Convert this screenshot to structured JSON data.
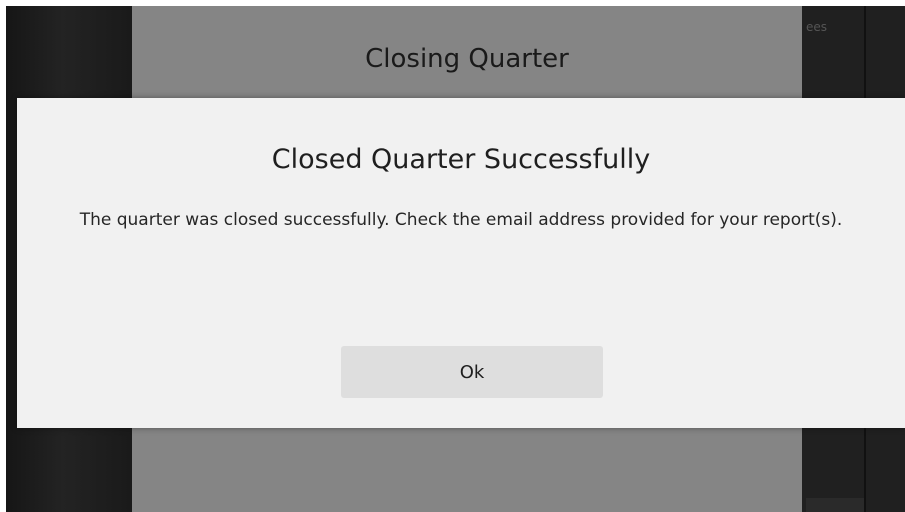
{
  "background": {
    "dialog_title": "Closing Quarter",
    "right_fragment": "ees"
  },
  "dialog": {
    "title": "Closed Quarter Successfully",
    "message": "The quarter was closed successfully. Check the email address provided for your report(s).",
    "ok_label": "Ok"
  },
  "colors": {
    "dialog_bg": "#f1f1f1",
    "behind_dialog_bg": "#858585",
    "button_bg": "#dedede",
    "app_bg": "#1b1b1b"
  }
}
